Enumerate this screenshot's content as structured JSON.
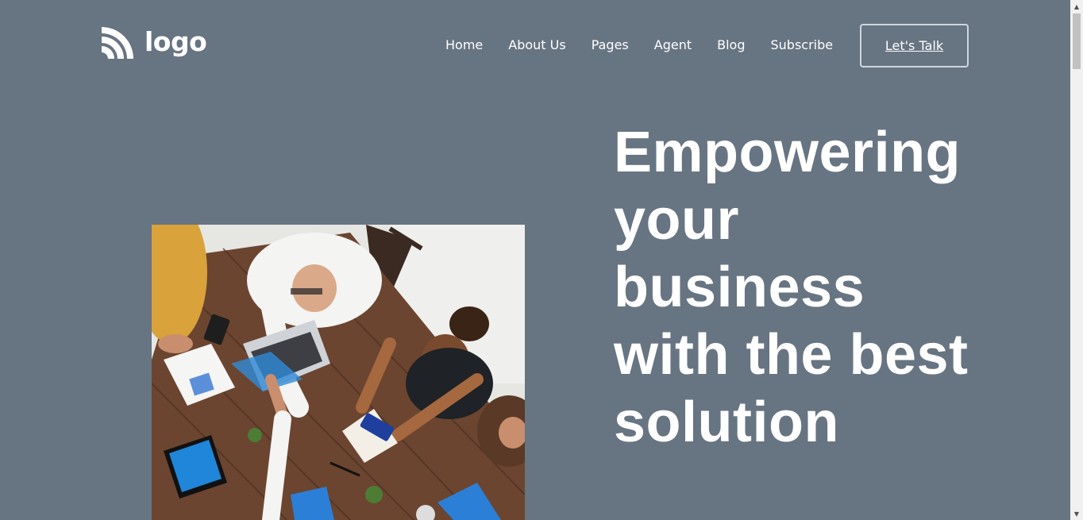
{
  "header": {
    "logo_text": "logo",
    "nav": [
      "Home",
      "About Us",
      "Pages",
      "Agent",
      "Blog",
      "Subscribe"
    ],
    "cta_label": "Let's Talk"
  },
  "hero": {
    "title": "Empowering your business with the best solution",
    "image_alt": "team meeting around a wooden table"
  },
  "colors": {
    "background": "#677482",
    "text": "#ffffff",
    "cta_border": "#cfd6de"
  },
  "scrollbar": {
    "up_icon": "▲",
    "down_icon": "▼"
  }
}
